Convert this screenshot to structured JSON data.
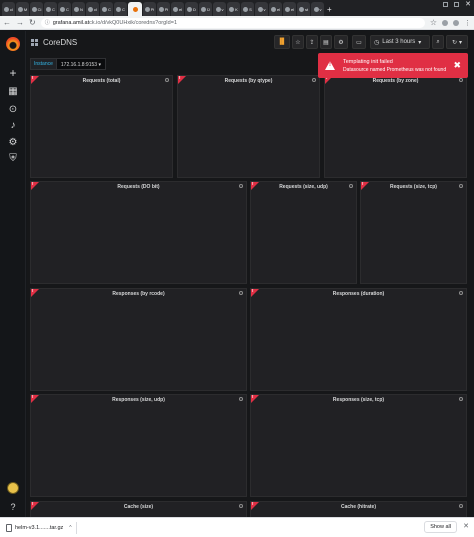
{
  "browser": {
    "tabs": [
      {
        "title": "cl"
      },
      {
        "title": "M"
      },
      {
        "title": "Ci"
      },
      {
        "title": "C"
      },
      {
        "title": "C"
      },
      {
        "title": "N"
      },
      {
        "title": "cl"
      },
      {
        "title": "C"
      },
      {
        "title": "C"
      },
      {
        "title": "",
        "active": true
      },
      {
        "title": "Pi"
      },
      {
        "title": "Pi"
      },
      {
        "title": "el"
      },
      {
        "title": "D"
      },
      {
        "title": "Ü"
      },
      {
        "title": "v"
      },
      {
        "title": "K"
      },
      {
        "title": "S"
      },
      {
        "title": "v"
      },
      {
        "title": "el"
      },
      {
        "title": "el"
      },
      {
        "title": "st"
      },
      {
        "title": "v"
      }
    ],
    "new_tab_label": "+",
    "close_label": "✕",
    "url_host": "grafana.amil.at",
    "url_path": "ck.io/d/vkQ0UHxik/coredns?orgId=1",
    "back_icon": "←",
    "forward_icon": "→",
    "reload_icon": "↻",
    "lock_icon": "ⓘ",
    "star_icon": "☆",
    "menu_icon": "⋮"
  },
  "sidebar": {
    "add_icon": "+",
    "dashboards_icon": "▦",
    "explore_icon": "⊙",
    "alerting_icon": "♪",
    "config_icon": "⚙",
    "shield_icon": "⛨",
    "help_icon": "?"
  },
  "dashboard": {
    "title": "CoreDNS",
    "time_picker_label": "Last 3 hours",
    "toolbar_icons": {
      "graph_add": "▐▌",
      "star": "☆",
      "share": "⇪",
      "save": "▤",
      "settings": "⚙",
      "tv": "▭",
      "clock": "◷",
      "zoom_out": "⌕",
      "refresh": "↻",
      "caret": "▾"
    },
    "variable": {
      "label": "Instance",
      "value": "172.16.1.8:9153"
    },
    "panels": [
      "Requests (total)",
      "Requests (by qtype)",
      "Requests (by zone)",
      "Requests (DO bit)",
      "Requests (size, udp)",
      "Requests (size, tcp)",
      "Responses (by rcode)",
      "Responses (duration)",
      "Responses (size, udp)",
      "Responses (size, tcp)",
      "Cache (size)",
      "Cache (hitrate)"
    ],
    "panel_error_mark": "!"
  },
  "alert": {
    "title": "Templating init failed",
    "detail": "Datasource named Prometheus was not found",
    "close": "✖"
  },
  "downloads": {
    "file_name": "helm-v3.1.......tar.gz",
    "show_all": "Show all",
    "close": "✕",
    "chevron": "^"
  },
  "colors": {
    "error_red": "#e02f44",
    "panel_bg": "#212124",
    "page_bg": "#161719",
    "accent_blue": "#33b5e5"
  }
}
